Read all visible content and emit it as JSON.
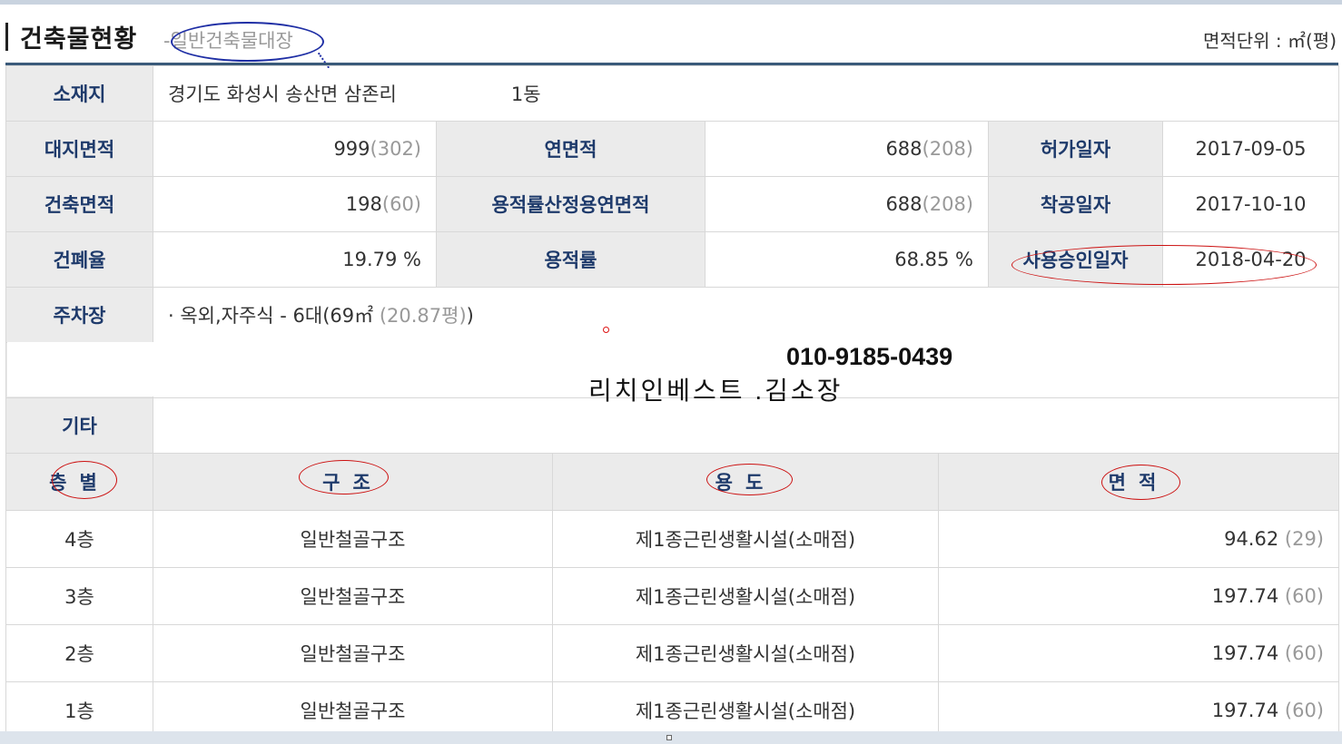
{
  "header": {
    "title": "건축물현황",
    "separator": "-",
    "subtitle": "일반건축물대장",
    "unit_label": "면적단위 : ㎡(평)"
  },
  "info": {
    "location": {
      "label": "소재지",
      "value": "경기도 화성시 송산면 삼존리",
      "building": "1동"
    },
    "land_area": {
      "label": "대지면적",
      "value": "999",
      "pyeong": "(302)"
    },
    "total_floor_area": {
      "label": "연면적",
      "value": "688",
      "pyeong": "(208)"
    },
    "permit_date": {
      "label": "허가일자",
      "value": "2017-09-05"
    },
    "building_area": {
      "label": "건축면적",
      "value": "198",
      "pyeong": "(60)"
    },
    "far_floor_area": {
      "label": "용적률산정용연면적",
      "value": "688",
      "pyeong": "(208)"
    },
    "start_date": {
      "label": "착공일자",
      "value": "2017-10-10"
    },
    "coverage_ratio": {
      "label": "건폐율",
      "value": "19.79 %"
    },
    "floor_area_ratio": {
      "label": "용적률",
      "value": "68.85 %"
    },
    "approval_date": {
      "label": "사용승인일자",
      "value": "2018-04-20"
    },
    "parking": {
      "label": "주차장",
      "value": "· 옥외,자주식 - 6대(69㎡",
      "pyeong": "(20.87평)",
      "close": ")"
    },
    "etc": {
      "label": "기타",
      "value": ""
    }
  },
  "overlay": {
    "phone": "010-9185-0439",
    "company": "리치인베스트 .김소장"
  },
  "floors": {
    "headers": [
      "층별",
      "구조",
      "용도",
      "면적"
    ],
    "rows": [
      {
        "floor": "4층",
        "structure": "일반철골구조",
        "use": "제1종근린생활시설(소매점)",
        "area": "94.62",
        "pyeong": "(29)"
      },
      {
        "floor": "3층",
        "structure": "일반철골구조",
        "use": "제1종근린생활시설(소매점)",
        "area": "197.74",
        "pyeong": "(60)"
      },
      {
        "floor": "2층",
        "structure": "일반철골구조",
        "use": "제1종근린생활시설(소매점)",
        "area": "197.74",
        "pyeong": "(60)"
      },
      {
        "floor": "1층",
        "structure": "일반철골구조",
        "use": "제1종근린생활시설(소매점)",
        "area": "197.74",
        "pyeong": "(60)"
      }
    ]
  },
  "colors": {
    "label_text": "#1e3a6b",
    "label_bg": "#ebebeb",
    "annotation_red": "#cc1111",
    "annotation_blue": "#1f2fa5"
  }
}
